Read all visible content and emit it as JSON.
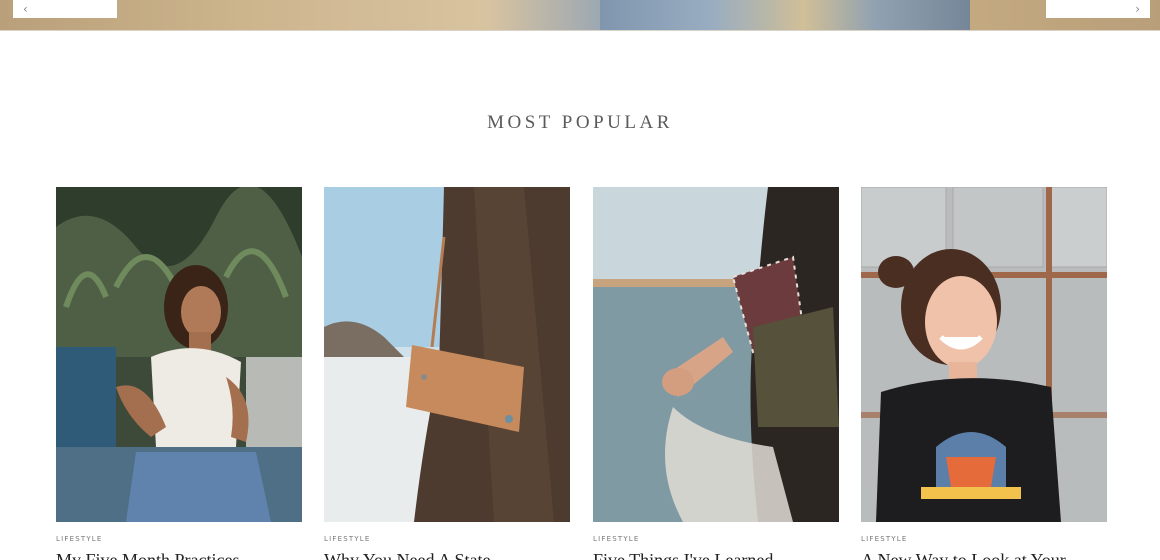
{
  "hero": {
    "prev_icon": "chevron-left-icon",
    "next_icon": "chevron-right-icon",
    "prev_glyph": "‹",
    "next_glyph": "›"
  },
  "section": {
    "title": "MOST POPULAR"
  },
  "posts": [
    {
      "category": "LIFESTYLE",
      "title": "My Five Month Practices",
      "image": "woman-sitting-by-pool-photo"
    },
    {
      "category": "LIFESTYLE",
      "title": "Why You Need A State",
      "image": "leather-crossbody-bag-beach-photo"
    },
    {
      "category": "LIFESTYLE",
      "title": "Five Things I've Learned",
      "image": "holding-hands-lake-photo"
    },
    {
      "category": "LIFESTYLE",
      "title": "A New Way to Look at Your",
      "image": "smiling-woman-journey-shirt-photo"
    }
  ]
}
